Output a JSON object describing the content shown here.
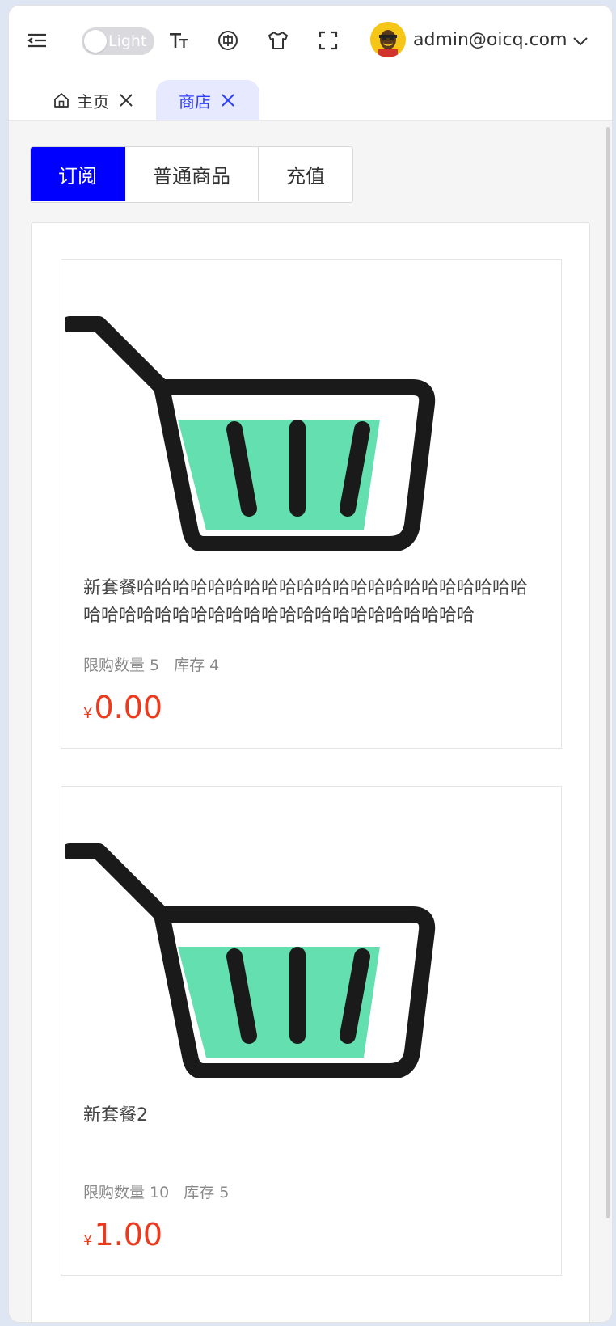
{
  "header": {
    "theme_toggle_label": "Light",
    "user_email": "admin@oicq.com"
  },
  "tabs": [
    {
      "label": "主页"
    },
    {
      "label": "商店"
    }
  ],
  "segments": [
    {
      "label": "订阅"
    },
    {
      "label": "普通商品"
    },
    {
      "label": "充值"
    }
  ],
  "products": [
    {
      "title": "新套餐哈哈哈哈哈哈哈哈哈哈哈哈哈哈哈哈哈哈哈哈哈哈哈哈哈哈哈哈哈哈哈哈哈哈哈哈哈哈哈哈哈哈哈哈",
      "limit": "限购数量 5",
      "stock": "库存 4",
      "currency": "¥",
      "price": "0.00"
    },
    {
      "title": "新套餐2",
      "limit": "限购数量 10",
      "stock": "库存 5",
      "currency": "¥",
      "price": "1.00"
    }
  ],
  "colors": {
    "accent": "#0000ff",
    "price": "#ee3a1c",
    "basket_fill": "#64e0b0"
  }
}
